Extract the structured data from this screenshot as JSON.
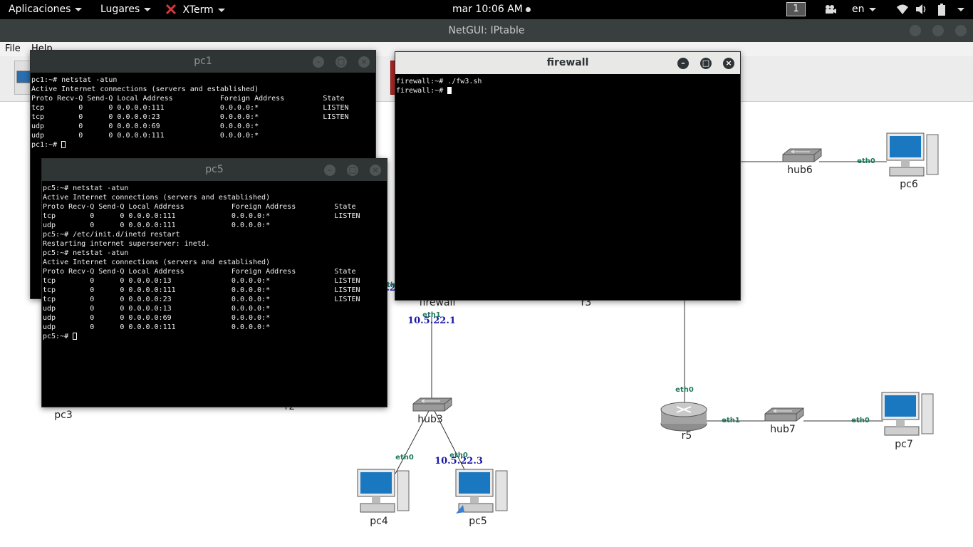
{
  "topbar": {
    "apps": "Aplicaciones",
    "places": "Lugares",
    "xterm": "XTerm",
    "clock": "mar 10:06 AM",
    "workspace": "1",
    "lang": "en"
  },
  "netgui": {
    "title": "NetGUI: IPtable",
    "menu": {
      "file": "File",
      "help": "Help"
    }
  },
  "nodes": {
    "firewall": "firewall",
    "r3": "r3",
    "r2": "r2",
    "r5": "r5",
    "pc3": "pc3",
    "pc4": "pc4",
    "pc5": "pc5",
    "pc6": "pc6",
    "pc7": "pc7",
    "hub3": "hub3",
    "hub6": "hub6",
    "hub7": "hub7"
  },
  "links": {
    "eth0": "eth0",
    "eth1": "eth1",
    "fw_ip": "10.5.22.1",
    "pc5_ip": "10.5.22.3",
    "partial_ip": ".2",
    "partial_eth": "th"
  },
  "terminals": {
    "pc1": {
      "title": "pc1",
      "lines": [
        "pc1:~# netstat -atun",
        "Active Internet connections (servers and established)",
        "Proto Recv-Q Send-Q Local Address           Foreign Address         State",
        "tcp        0      0 0.0.0.0:111             0.0.0.0:*               LISTEN",
        "tcp        0      0 0.0.0.0:23              0.0.0.0:*               LISTEN",
        "udp        0      0 0.0.0.0:69              0.0.0.0:*",
        "udp        0      0 0.0.0.0:111             0.0.0.0:*"
      ],
      "prompt": "pc1:~# "
    },
    "pc5": {
      "title": "pc5",
      "lines": [
        "pc5:~# netstat -atun",
        "Active Internet connections (servers and established)",
        "Proto Recv-Q Send-Q Local Address           Foreign Address         State",
        "tcp        0      0 0.0.0.0:111             0.0.0.0:*               LISTEN",
        "udp        0      0 0.0.0.0:111             0.0.0.0:*",
        "pc5:~# /etc/init.d/inetd restart",
        "Restarting internet superserver: inetd.",
        "pc5:~# netstat -atun",
        "Active Internet connections (servers and established)",
        "Proto Recv-Q Send-Q Local Address           Foreign Address         State",
        "tcp        0      0 0.0.0.0:13              0.0.0.0:*               LISTEN",
        "tcp        0      0 0.0.0.0:111             0.0.0.0:*               LISTEN",
        "tcp        0      0 0.0.0.0:23              0.0.0.0:*               LISTEN",
        "udp        0      0 0.0.0.0:13              0.0.0.0:*",
        "udp        0      0 0.0.0.0:69              0.0.0.0:*",
        "udp        0      0 0.0.0.0:111             0.0.0.0:*"
      ],
      "prompt": "pc5:~# "
    },
    "firewall": {
      "title": "firewall",
      "lines": [
        "firewall:~# ./fw3.sh"
      ],
      "prompt": "firewall:~# "
    }
  },
  "colors": {
    "eth_label": "#1e7a5e",
    "ip_label": "#1a1aa6",
    "topbar": "#000000",
    "terminal_bg": "#000000"
  }
}
